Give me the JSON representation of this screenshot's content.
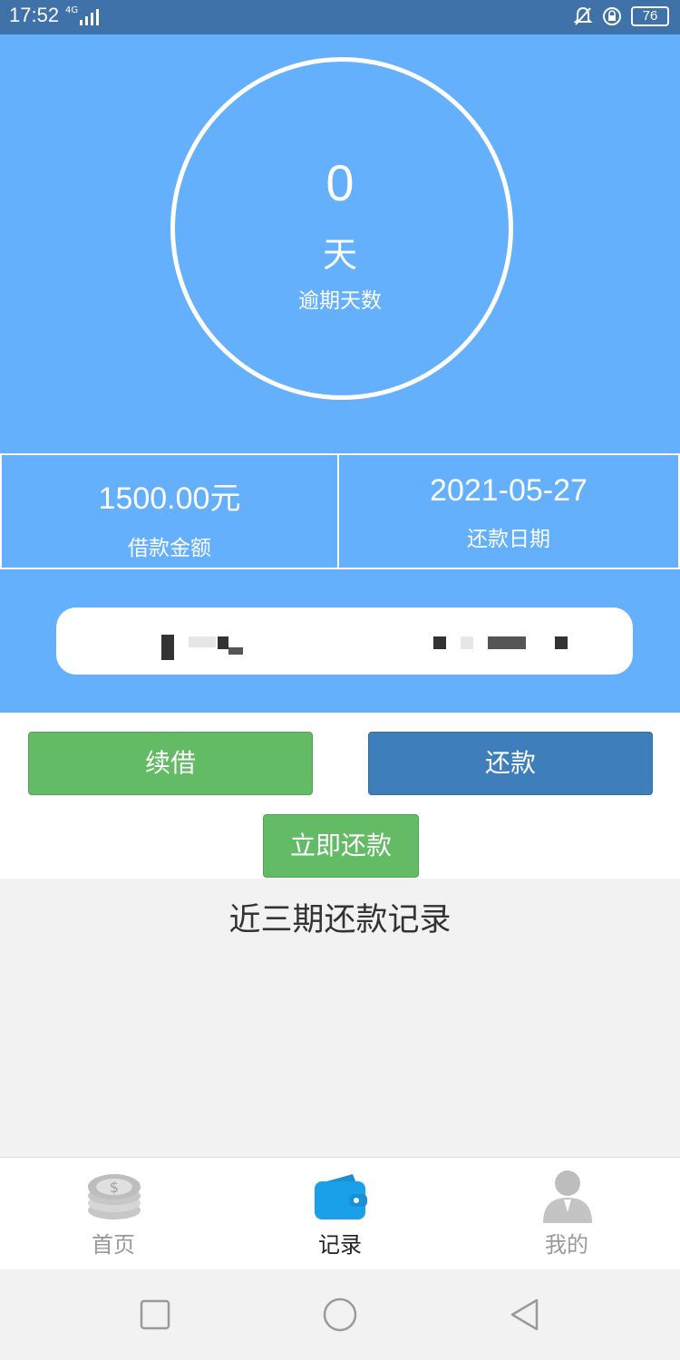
{
  "status_bar": {
    "time": "17:52",
    "network": "4G",
    "battery": "76",
    "icons": [
      "signal-icon",
      "mute-bell-icon",
      "lock-rotation-icon",
      "battery-icon"
    ]
  },
  "overdue": {
    "days": "0",
    "unit": "天",
    "label": "逾期天数"
  },
  "loan": {
    "amount": "1500.00元",
    "amount_label": "借款金额",
    "due_date": "2021-05-27",
    "due_date_label": "还款日期"
  },
  "buttons": {
    "renew": "续借",
    "repay": "还款",
    "repay_now": "立即还款"
  },
  "records": {
    "title": "近三期还款记录"
  },
  "tabs": [
    {
      "label": "首页",
      "icon": "coins-icon"
    },
    {
      "label": "记录",
      "icon": "wallet-icon"
    },
    {
      "label": "我的",
      "icon": "user-icon"
    }
  ],
  "colors": {
    "hero_bg": "#64b0fd",
    "status_bar": "#3f72a8",
    "green_button": "#64bb66",
    "blue_button": "#3e7fbb"
  }
}
